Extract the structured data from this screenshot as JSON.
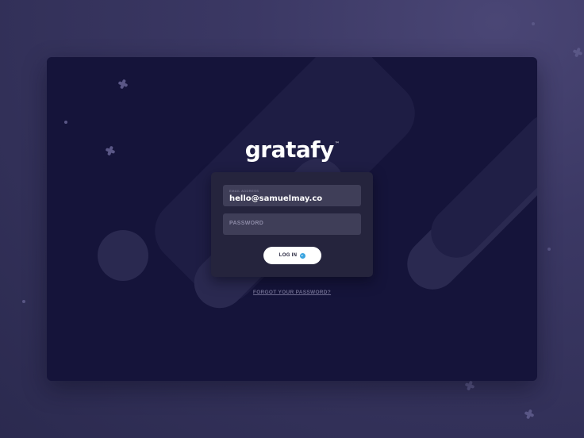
{
  "brand": {
    "logo_text": "gratafy",
    "trademark": "™"
  },
  "form": {
    "email_label": "EMAIL ADDRESS",
    "email_value": "hello@samuelmay.co",
    "password_placeholder": "PASSWORD",
    "login_label": "LOG IN",
    "forgot_label": "FORGOT YOUR PASSWORD?"
  },
  "colors": {
    "background": "#3b3864",
    "card": "#15143a",
    "login_box": "#25243d",
    "field": "#3f3e58",
    "button": "#ffffff",
    "accent": "#3aa4e0"
  },
  "icons": {
    "login_button_icon": "arrow-right-circle-icon"
  }
}
